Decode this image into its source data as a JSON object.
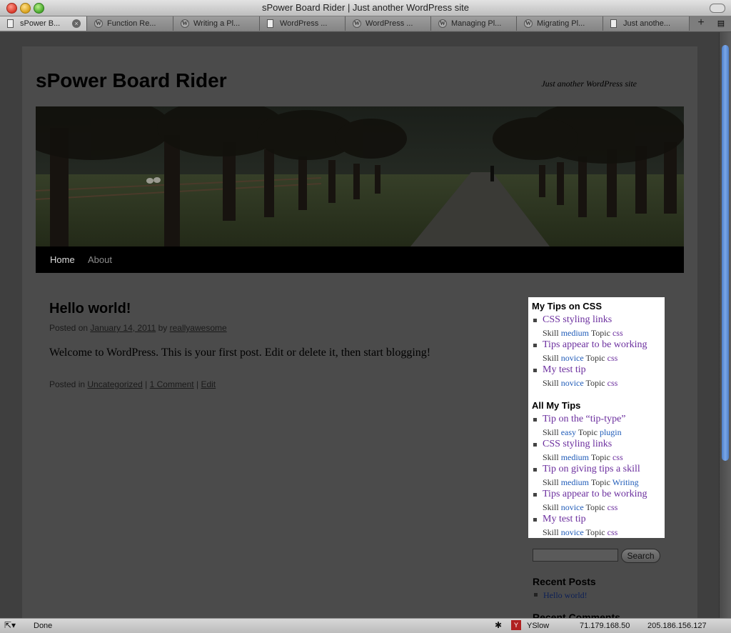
{
  "window": {
    "title": "sPower Board Rider | Just another WordPress site"
  },
  "tabs": [
    {
      "label": "sPower B...",
      "icon": "document-icon",
      "active": true
    },
    {
      "label": "Function Re...",
      "icon": "wordpress-icon"
    },
    {
      "label": "Writing a Pl...",
      "icon": "wordpress-icon"
    },
    {
      "label": "WordPress ...",
      "icon": "document-icon"
    },
    {
      "label": "WordPress ...",
      "icon": "wordpress-icon"
    },
    {
      "label": "Managing Pl...",
      "icon": "wordpress-icon"
    },
    {
      "label": "Migrating Pl...",
      "icon": "wordpress-icon"
    },
    {
      "label": "Just anothe...",
      "icon": "document-icon"
    }
  ],
  "site": {
    "title": "sPower Board Rider",
    "description": "Just another WordPress site"
  },
  "nav": {
    "home": "Home",
    "about": "About"
  },
  "post": {
    "title": "Hello world!",
    "meta_prefix": "Posted on",
    "date": "January 14, 2011",
    "by": "by",
    "author": "reallyawesome",
    "body": "Welcome to WordPress. This is your first post. Edit or delete it, then start blogging!",
    "posted_in": "Posted in",
    "category": "Uncategorized",
    "sep": "|",
    "comments": "1 Comment",
    "edit": "Edit"
  },
  "widget_css": {
    "title": "My Tips on CSS",
    "items": [
      {
        "title": "CSS styling links",
        "skill": "medium",
        "topic": "css"
      },
      {
        "title": "Tips appear to be working",
        "skill": "novice",
        "topic": "css"
      },
      {
        "title": "My test tip",
        "skill": "novice",
        "topic": "css"
      }
    ]
  },
  "widget_all": {
    "title": "All My Tips",
    "items": [
      {
        "title": "Tip on the “tip-type”",
        "skill": "easy",
        "topic": "plugin"
      },
      {
        "title": "CSS styling links",
        "skill": "medium",
        "topic": "css"
      },
      {
        "title": "Tip on giving tips a skill",
        "skill": "medium",
        "topic": "Writing"
      },
      {
        "title": "Tips appear to be working",
        "skill": "novice",
        "topic": "css"
      },
      {
        "title": "My test tip",
        "skill": "novice",
        "topic": "css"
      }
    ]
  },
  "labels": {
    "skill": "Skill",
    "topic": "Topic"
  },
  "sidebar": {
    "search_button": "Search",
    "recent_posts_title": "Recent Posts",
    "recent_posts": [
      "Hello world!"
    ],
    "recent_comments_title": "Recent Comments"
  },
  "status": {
    "text": "Done",
    "yslow": "YSlow",
    "ip1": "71.179.168.50",
    "ip2": "205.186.156.127"
  },
  "colors": {
    "link": "#6b2e9e",
    "meta_link": "#1f5bb8",
    "scroll_thumb": "#5b8fd8"
  }
}
